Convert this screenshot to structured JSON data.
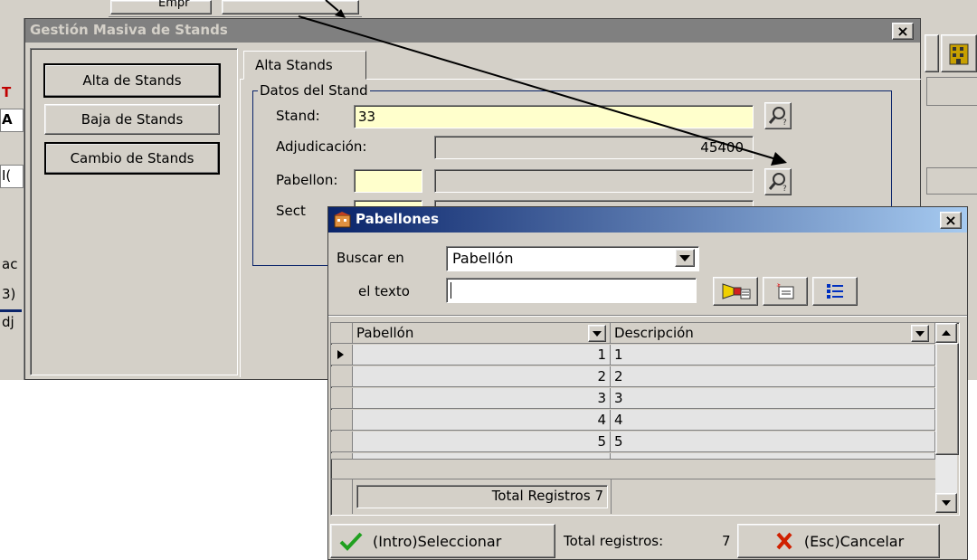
{
  "behind": {
    "top_label": "Empr",
    "left_chars": [
      "T",
      "A",
      "I(",
      "ac",
      "3)",
      "dj"
    ]
  },
  "main_window": {
    "title": "Gestión Masiva de Stands",
    "close_glyph": "×",
    "side_buttons": [
      {
        "label": "Alta de Stands",
        "selected": true
      },
      {
        "label": "Baja de Stands",
        "selected": false
      },
      {
        "label": "Cambio de Stands",
        "selected": false
      }
    ],
    "tab_label": "Alta Stands",
    "group_label": "Datos del Stand",
    "stand": {
      "label": "Stand:",
      "value": "33"
    },
    "adjudicacion": {
      "label": "Adjudicación:",
      "value": "45400"
    },
    "pabellon": {
      "label": "Pabellon:",
      "value": "",
      "desc": ""
    },
    "sector": {
      "label": "Sect"
    }
  },
  "popup": {
    "title": "Pabellones",
    "close_glyph": "×",
    "search": {
      "label": "Buscar en",
      "value": "Pabellón",
      "text_label": "el texto",
      "text_value": ""
    },
    "grid": {
      "headers": [
        "Pabellón",
        "Descripción"
      ],
      "rows": [
        {
          "pabellon": "1",
          "descripcion": "1"
        },
        {
          "pabellon": "2",
          "descripcion": "2"
        },
        {
          "pabellon": "3",
          "descripcion": "3"
        },
        {
          "pabellon": "4",
          "descripcion": "4"
        },
        {
          "pabellon": "5",
          "descripcion": "5"
        }
      ],
      "footer": "Total Registros 7"
    },
    "select_button": "(Intro)Seleccionar",
    "total_label": "Total registros:",
    "total_value": "7",
    "cancel_button": "(Esc)Cancelar"
  },
  "colors": {
    "titlebar": "#808080",
    "popup_title_start": "#0a246a",
    "popup_title_end": "#a6caf0",
    "field": "#ffffcc",
    "face": "#d4d0c8"
  }
}
